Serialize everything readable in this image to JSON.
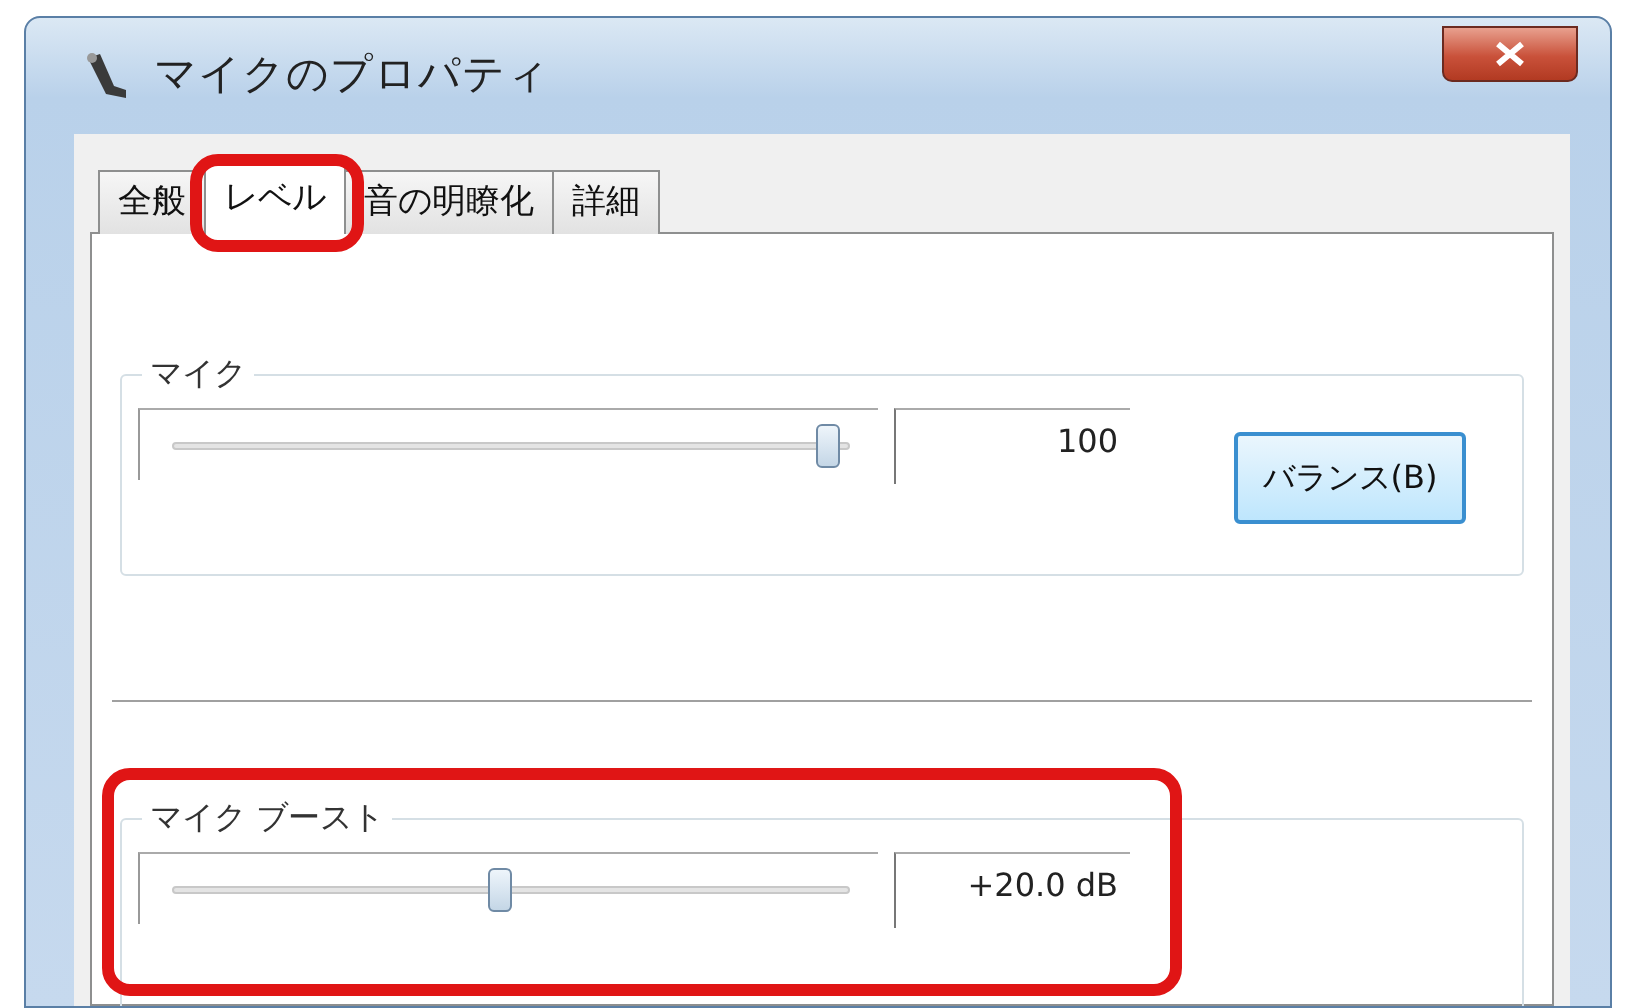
{
  "window": {
    "title": "マイクのプロパティ"
  },
  "tabs": [
    {
      "label": "全般",
      "selected": false
    },
    {
      "label": "レベル",
      "selected": true
    },
    {
      "label": "音の明瞭化",
      "selected": false
    },
    {
      "label": "詳細",
      "selected": false
    }
  ],
  "groups": [
    {
      "label": "マイク",
      "level": 1,
      "reading": "100",
      "button": "バランス(B)"
    },
    {
      "label": "マイク ブースト",
      "level": 0.5,
      "reading": "+20.0 dB"
    }
  ]
}
